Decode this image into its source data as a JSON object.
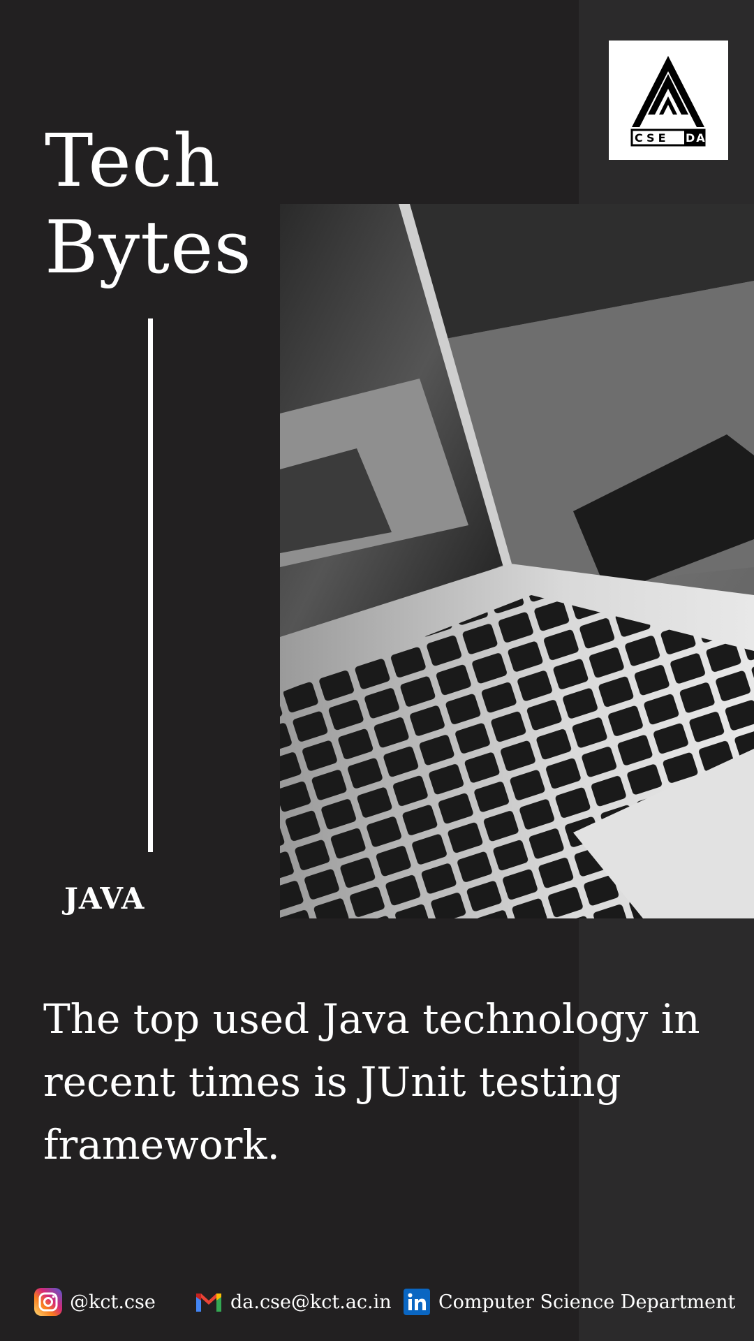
{
  "header": {
    "title_line1": "Tech",
    "title_line2": "Bytes",
    "logo_label": "CSEDA"
  },
  "topic": "JAVA",
  "body": {
    "text": "The top used Java technology in recent times is JUnit testing framework."
  },
  "photo": {
    "icon": "laptop-photo"
  },
  "footer": {
    "instagram": {
      "icon": "instagram-icon",
      "text": "@kct.cse"
    },
    "email": {
      "icon": "gmail-icon",
      "text": "da.cse@kct.ac.in"
    },
    "linkedin": {
      "icon": "linkedin-icon",
      "text": "Computer Science Department"
    }
  },
  "colors": {
    "background": "#222021",
    "panel_right": "#2b2a2b",
    "text": "#ffffff"
  }
}
